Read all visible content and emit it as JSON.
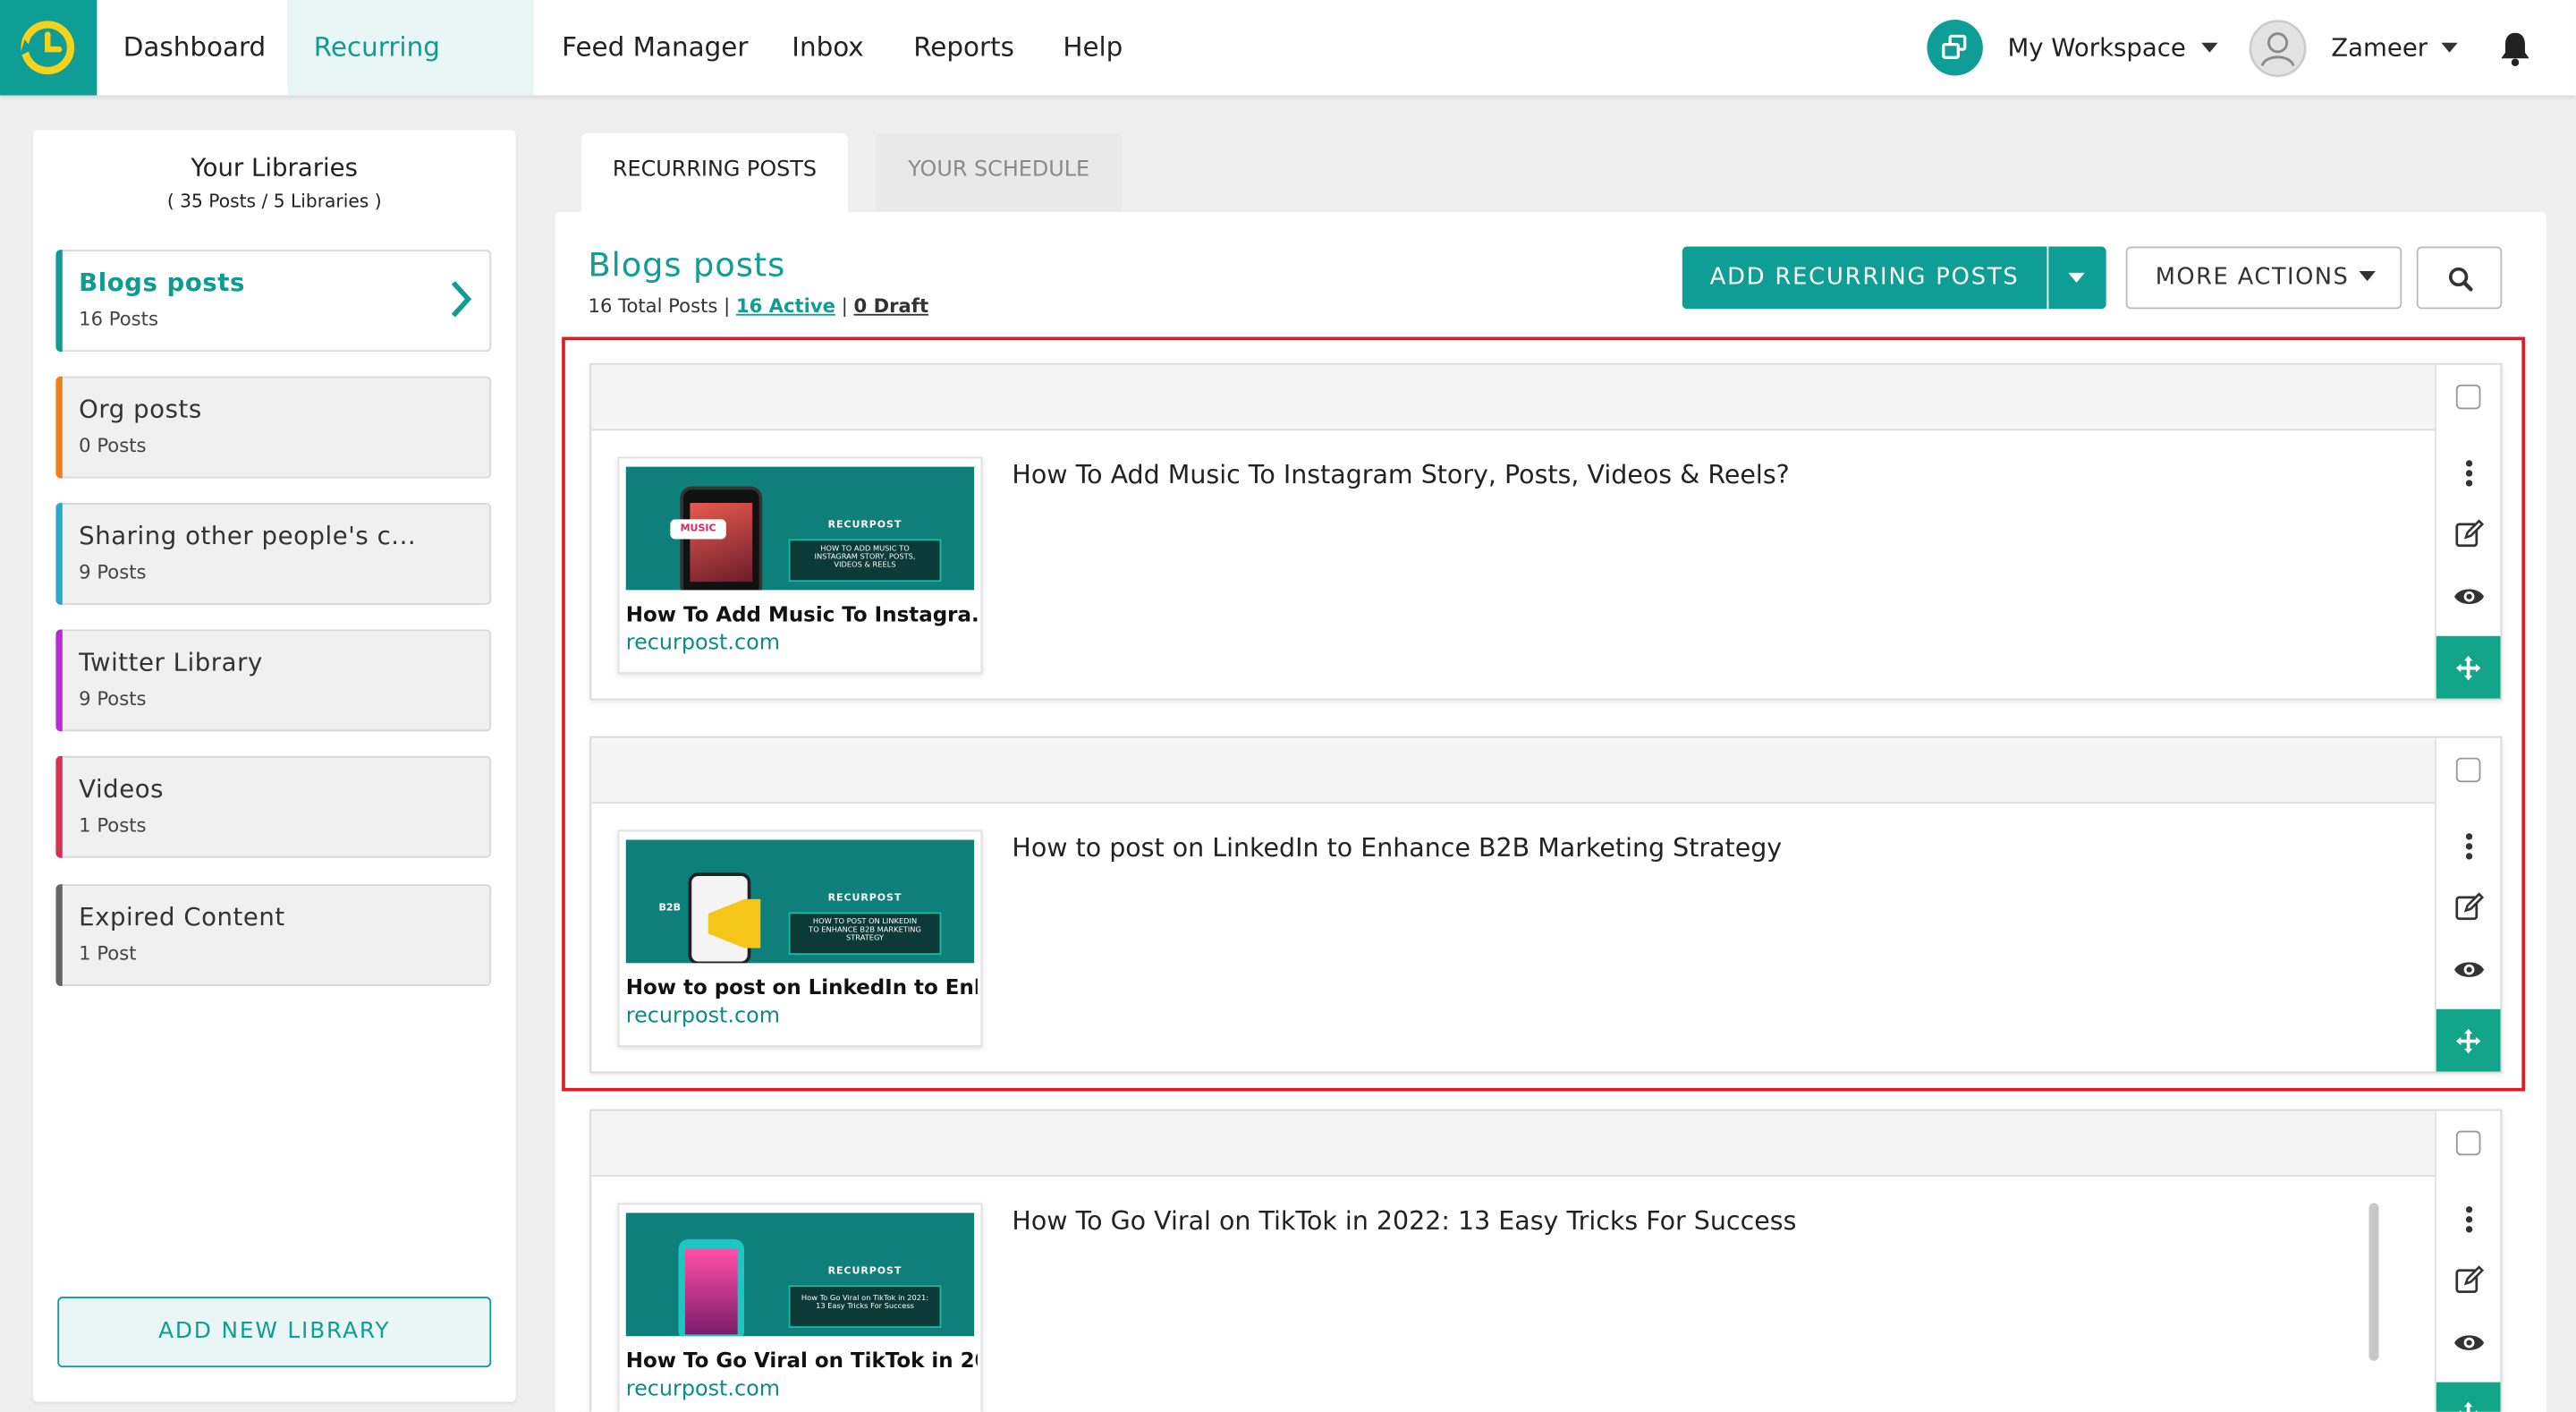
{
  "nav": {
    "items": [
      "Dashboard",
      "Recurring Posts",
      "Feed Manager",
      "Inbox",
      "Reports",
      "Help"
    ],
    "active": "Recurring Posts",
    "workspace_label": "My Workspace",
    "user_label": "Zameer"
  },
  "sidebar": {
    "title": "Your Libraries",
    "subtitle": "( 35 Posts / 5 Libraries )",
    "libraries": [
      {
        "name": "Blogs posts",
        "count": "16 Posts",
        "color": "#0e9e95",
        "active": true
      },
      {
        "name": "Org posts",
        "count": "0 Posts",
        "color": "#f07f1a",
        "active": false
      },
      {
        "name": "Sharing other people's c...",
        "count": "9 Posts",
        "color": "#2aa7c9",
        "active": false
      },
      {
        "name": "Twitter Library",
        "count": "9 Posts",
        "color": "#b52cd4",
        "active": false
      },
      {
        "name": "Videos",
        "count": "1 Posts",
        "color": "#d9304f",
        "active": false
      },
      {
        "name": "Expired Content",
        "count": "1 Post",
        "color": "#666666",
        "active": false
      }
    ],
    "add_button": "ADD NEW LIBRARY"
  },
  "tabs": {
    "recurring": "RECURRING POSTS",
    "schedule": "YOUR SCHEDULE"
  },
  "main": {
    "title": "Blogs posts",
    "total": "16 Total Posts",
    "sep": "|",
    "active_link": "16 Active",
    "draft_link": "0 Draft",
    "add_button": "ADD RECURRING POSTS",
    "more_button": "MORE ACTIONS"
  },
  "posts": [
    {
      "text": "How To Add Music To Instagram Story, Posts, Videos & Reels?",
      "preview_title": "How To Add Music To Instagra...",
      "domain": "recurpost.com",
      "thumb": {
        "brand": "RECURPOST",
        "line1": "HOW TO ADD MUSIC TO",
        "line2": "INSTAGRAM STORY, POSTS,",
        "line3": "VIDEOS & REELS",
        "tag": "MUSIC"
      }
    },
    {
      "text": "How to post on LinkedIn to Enhance B2B Marketing Strategy",
      "preview_title": "How to post on LinkedIn to Enh...",
      "domain": "recurpost.com",
      "thumb": {
        "brand": "RECURPOST",
        "line1": "HOW TO POST ON LINKEDIN",
        "line2": "TO ENHANCE B2B MARKETING",
        "line3": "STRATEGY",
        "tag": "B2B"
      }
    },
    {
      "text": "How To Go Viral on TikTok in 2022: 13 Easy Tricks For Success",
      "preview_title": "How To Go Viral on TikTok in 20...",
      "domain": "recurpost.com",
      "thumb": {
        "brand": "RECURPOST",
        "line1": "How To Go Viral on TikTok in 2021:",
        "line2": "13 Easy Tricks For Success",
        "line3": "",
        "tag": ""
      }
    }
  ],
  "colors": {
    "accent": "#0e9e95",
    "move_button": "#12a58a",
    "highlight": "#e11b22"
  },
  "icons": [
    "clock-logo-icon",
    "workspace-switch-icon",
    "user-avatar-icon",
    "bell-icon",
    "chevron-right-icon",
    "search-icon",
    "kebab-menu-icon",
    "edit-icon",
    "eye-icon",
    "move-arrows-icon"
  ]
}
